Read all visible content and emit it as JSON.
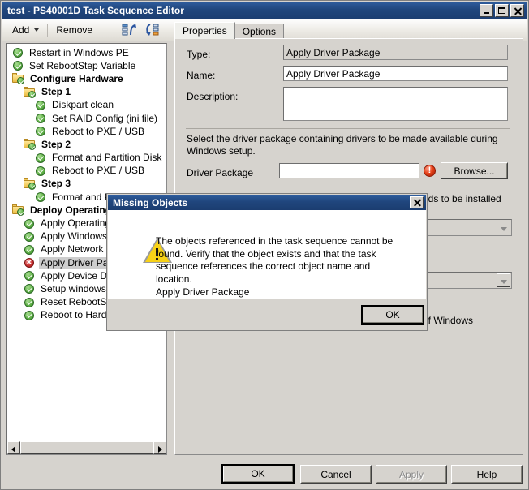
{
  "window": {
    "title": "test - PS40001D Task Sequence Editor",
    "buttons": {
      "minimize": "minimize-button",
      "maximize": "maximize-button",
      "close": "close-button"
    }
  },
  "toolbar": {
    "add_label": "Add",
    "remove_label": "Remove",
    "move_up_icon": "move-up-icon",
    "move_down_icon": "move-down-icon"
  },
  "tree": {
    "items": [
      {
        "label": "Restart in Windows PE",
        "icon": "check",
        "indent": 0,
        "bold": false,
        "selected": false
      },
      {
        "label": "Set RebootStep Variable",
        "icon": "check",
        "indent": 0,
        "bold": false,
        "selected": false
      },
      {
        "label": "Configure Hardware",
        "icon": "folder",
        "indent": 0,
        "bold": true,
        "selected": false
      },
      {
        "label": "Step 1",
        "icon": "folder",
        "indent": 1,
        "bold": true,
        "selected": false
      },
      {
        "label": "Diskpart clean",
        "icon": "check",
        "indent": 2,
        "bold": false,
        "selected": false
      },
      {
        "label": "Set RAID Config (ini file)",
        "icon": "check",
        "indent": 2,
        "bold": false,
        "selected": false
      },
      {
        "label": "Reboot to PXE / USB",
        "icon": "check",
        "indent": 2,
        "bold": false,
        "selected": false
      },
      {
        "label": "Step 2",
        "icon": "folder",
        "indent": 1,
        "bold": true,
        "selected": false
      },
      {
        "label": "Format and Partition Disk",
        "icon": "check",
        "indent": 2,
        "bold": false,
        "selected": false
      },
      {
        "label": "Reboot to PXE / USB",
        "icon": "check",
        "indent": 2,
        "bold": false,
        "selected": false
      },
      {
        "label": "Step 3",
        "icon": "folder",
        "indent": 1,
        "bold": true,
        "selected": false
      },
      {
        "label": "Format and Partition Disk",
        "icon": "check",
        "indent": 2,
        "bold": false,
        "selected": false
      },
      {
        "label": "Deploy Operating System",
        "icon": "folder",
        "indent": 0,
        "bold": true,
        "selected": false
      },
      {
        "label": "Apply Operating System",
        "icon": "check",
        "indent": 1,
        "bold": false,
        "selected": false
      },
      {
        "label": "Apply Windows Settings",
        "icon": "check",
        "indent": 1,
        "bold": false,
        "selected": false
      },
      {
        "label": "Apply Network Settings",
        "icon": "check",
        "indent": 1,
        "bold": false,
        "selected": false
      },
      {
        "label": "Apply Driver Package",
        "icon": "errx",
        "indent": 1,
        "bold": false,
        "selected": true
      },
      {
        "label": "Apply Device Drivers",
        "icon": "check",
        "indent": 1,
        "bold": false,
        "selected": false
      },
      {
        "label": "Setup windows and ConfigMgr",
        "icon": "check",
        "indent": 1,
        "bold": false,
        "selected": false
      },
      {
        "label": "Reset RebootStep Variable",
        "icon": "check",
        "indent": 1,
        "bold": false,
        "selected": false
      },
      {
        "label": "Reboot to Hard Disk",
        "icon": "check",
        "indent": 1,
        "bold": false,
        "selected": false
      }
    ]
  },
  "tabs": [
    {
      "label": "Properties",
      "active": true
    },
    {
      "label": "Options",
      "active": false
    }
  ],
  "properties": {
    "type_label": "Type:",
    "type_value": "Apply Driver Package",
    "name_label": "Name:",
    "name_value": "Apply Driver Package",
    "description_label": "Description:",
    "description_value": "",
    "instruction": "Select the driver package containing drivers to be made available during Windows setup.",
    "driver_package_label": "Driver Package",
    "driver_package_value": "",
    "driver_package_error_icon": "error-icon",
    "browse_label": "Browse...",
    "occluded_text_1": "eds to be installed",
    "occluded_text_2": "of Windows",
    "combo_1_value": "",
    "combo_2_value": ""
  },
  "footer": {
    "ok": "OK",
    "cancel": "Cancel",
    "apply": "Apply",
    "help": "Help"
  },
  "dialog": {
    "title": "Missing Objects",
    "warning_icon": "warning-icon",
    "message": "The objects referenced in the task sequence cannot be found. Verify that the object exists and that the task sequence references the correct object name and location.",
    "object_name": "Apply Driver Package",
    "ok": "OK",
    "close_icon": "close-icon"
  },
  "colors": {
    "titlebar": "#20467d",
    "face": "#d6d3ce",
    "error_red": "#e64119",
    "ok_green": "#63b44a",
    "warning_yellow": "#f7d117"
  }
}
